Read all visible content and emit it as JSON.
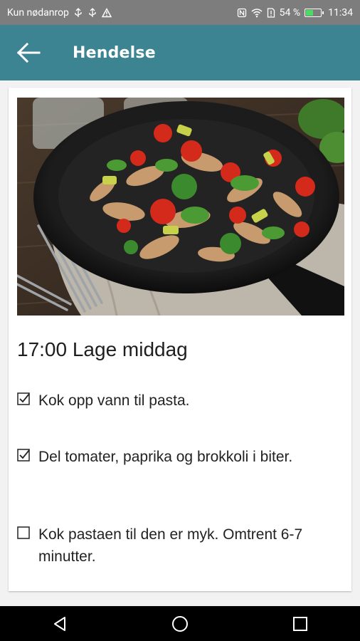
{
  "status_bar": {
    "carrier": "Kun nødanrop",
    "battery": "54 %",
    "battery_level": 0.54,
    "time": "11:34"
  },
  "app_bar": {
    "title": "Hendelse",
    "back_icon": "arrow-left-icon",
    "color": "#3d8493"
  },
  "event": {
    "title": "17:00 Lage middag",
    "image": "pasta-skillet-photo",
    "tasks": [
      {
        "text": "Kok opp vann til pasta.",
        "checked": true
      },
      {
        "text": "Del tomater, paprika og brokkoli i biter.",
        "checked": true
      },
      {
        "text": "Kok pastaen til den er myk. Omtrent 6-7 minutter.",
        "checked": false
      }
    ]
  },
  "nav_bar": {
    "back": "triangle-back-icon",
    "home": "circle-home-icon",
    "recents": "square-recents-icon"
  }
}
